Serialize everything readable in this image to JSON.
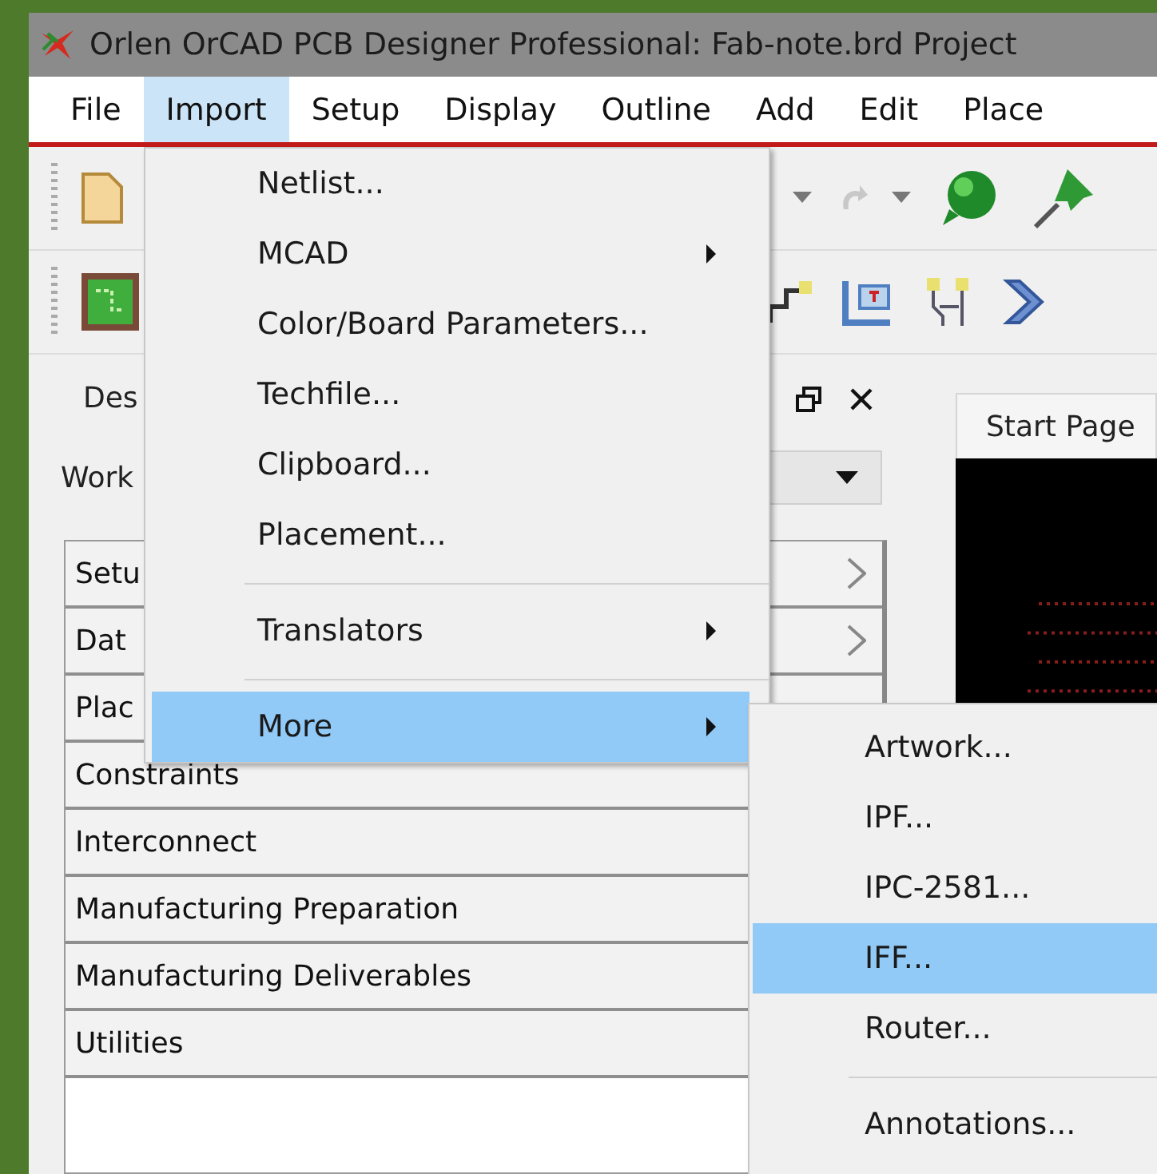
{
  "window": {
    "title": "Orlen OrCAD PCB Designer Professional: Fab-note.brd  Project"
  },
  "menu_bar": [
    {
      "label": "File",
      "selected": false
    },
    {
      "label": "Import",
      "selected": true
    },
    {
      "label": "Setup",
      "selected": false
    },
    {
      "label": "Display",
      "selected": false
    },
    {
      "label": "Outline",
      "selected": false
    },
    {
      "label": "Add",
      "selected": false
    },
    {
      "label": "Edit",
      "selected": false
    },
    {
      "label": "Place",
      "selected": false
    }
  ],
  "panel": {
    "tab": "Des",
    "workspace_label": "Work",
    "sections": [
      {
        "label": "Setu",
        "has_arrow": true
      },
      {
        "label": "Dat",
        "has_arrow": true
      },
      {
        "label": "Plac",
        "has_arrow": false
      },
      {
        "label": "Constraints",
        "has_arrow": false
      },
      {
        "label": "Interconnect",
        "has_arrow": false
      },
      {
        "label": "Manufacturing Preparation",
        "has_arrow": false
      },
      {
        "label": "Manufacturing Deliverables",
        "has_arrow": false
      },
      {
        "label": "Utilities",
        "has_arrow": false
      }
    ]
  },
  "document_tab": {
    "label": "Start Page"
  },
  "import_menu": [
    {
      "kind": "item",
      "label": "Netlist...",
      "selected": false
    },
    {
      "kind": "submenu",
      "label": "MCAD",
      "selected": false
    },
    {
      "kind": "item",
      "label": "Color/Board Parameters...",
      "selected": false
    },
    {
      "kind": "item",
      "label": "Techfile...",
      "selected": false
    },
    {
      "kind": "item",
      "label": "Clipboard...",
      "selected": false
    },
    {
      "kind": "item",
      "label": "Placement...",
      "selected": false
    },
    {
      "kind": "separator"
    },
    {
      "kind": "submenu",
      "label": "Translators",
      "selected": false
    },
    {
      "kind": "separator"
    },
    {
      "kind": "submenu",
      "label": "More",
      "selected": true
    }
  ],
  "more_submenu": [
    {
      "kind": "item",
      "label": "Artwork...",
      "selected": false
    },
    {
      "kind": "item",
      "label": "IPF...",
      "selected": false
    },
    {
      "kind": "item",
      "label": "IPC-2581...",
      "selected": false
    },
    {
      "kind": "item",
      "label": "IFF...",
      "selected": true
    },
    {
      "kind": "item",
      "label": "Router...",
      "selected": false
    },
    {
      "kind": "separator"
    },
    {
      "kind": "item",
      "label": "Annotations...",
      "selected": false
    }
  ]
}
